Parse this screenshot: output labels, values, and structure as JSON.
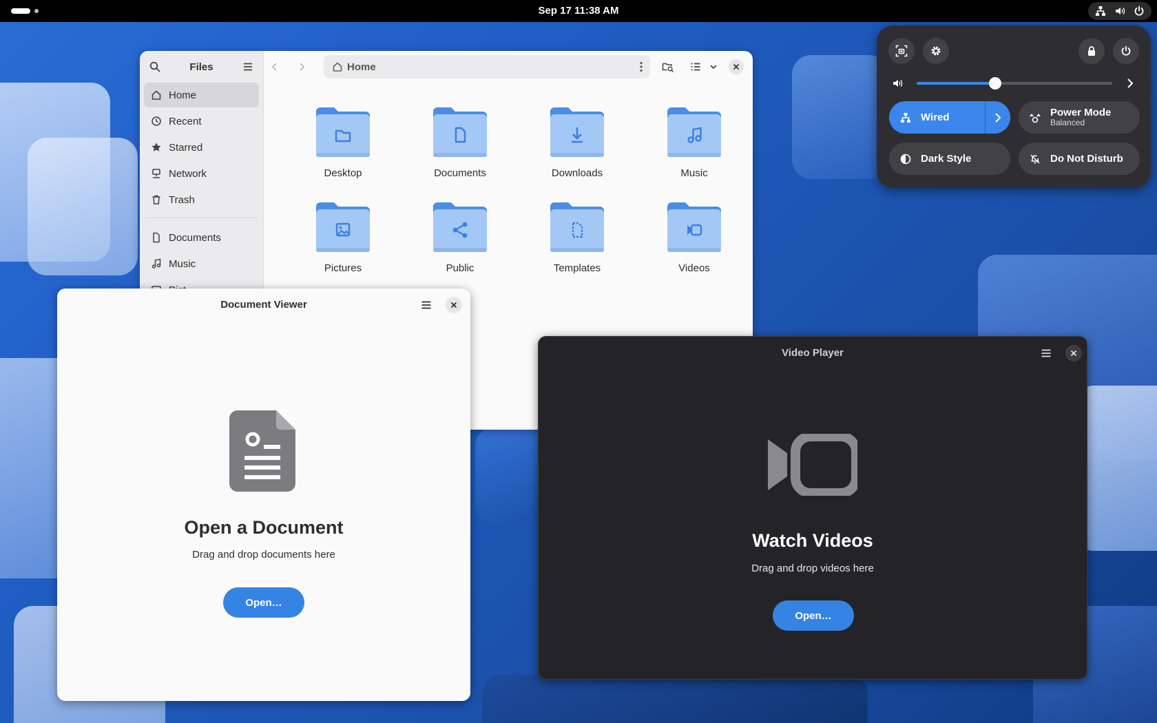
{
  "topbar": {
    "clock": "Sep 17  11:38 AM"
  },
  "quick_settings": {
    "volume_fraction": 0.4,
    "tiles": {
      "wired": "Wired",
      "power_mode": "Power Mode",
      "power_mode_sub": "Balanced",
      "dark_style": "Dark Style",
      "dnd": "Do Not Disturb"
    }
  },
  "files": {
    "title": "Files",
    "path": "Home",
    "sidebar": [
      {
        "label": "Home",
        "icon": "home-icon"
      },
      {
        "label": "Recent",
        "icon": "clock-icon"
      },
      {
        "label": "Starred",
        "icon": "star-icon"
      },
      {
        "label": "Network",
        "icon": "network-icon"
      },
      {
        "label": "Trash",
        "icon": "trash-icon"
      },
      {
        "label": "Documents",
        "icon": "document-icon"
      },
      {
        "label": "Music",
        "icon": "music-icon"
      },
      {
        "label": "Pict",
        "icon": "picture-icon"
      }
    ],
    "folders": [
      {
        "name": "Desktop",
        "icon": "folder-icon"
      },
      {
        "name": "Documents",
        "icon": "document-icon"
      },
      {
        "name": "Downloads",
        "icon": "download-icon"
      },
      {
        "name": "Music",
        "icon": "music-icon"
      },
      {
        "name": "Pictures",
        "icon": "picture-icon"
      },
      {
        "name": "Public",
        "icon": "share-icon"
      },
      {
        "name": "Templates",
        "icon": "template-icon"
      },
      {
        "name": "Videos",
        "icon": "video-icon"
      }
    ]
  },
  "document_viewer": {
    "title": "Document Viewer",
    "heading": "Open a Document",
    "subtitle": "Drag and drop documents here",
    "button": "Open…"
  },
  "video_player": {
    "title": "Video Player",
    "heading": "Watch Videos",
    "subtitle": "Drag and drop videos here",
    "button": "Open…"
  },
  "colors": {
    "accent": "#3584e4",
    "folder": "#a4c8f5",
    "folder_tab": "#4a8ee8",
    "folder_glyph": "#3a7fe0"
  }
}
